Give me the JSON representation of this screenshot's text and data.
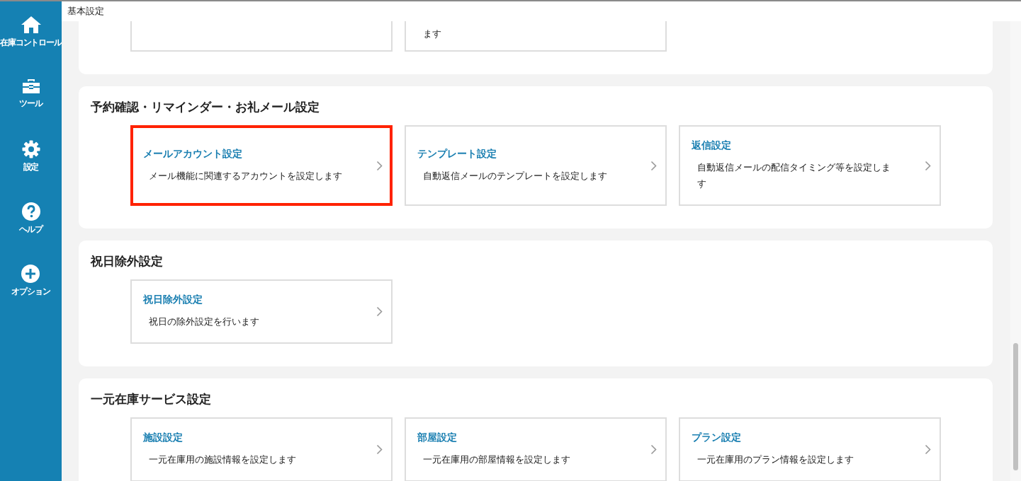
{
  "sidebar": {
    "items": [
      {
        "kind": "home",
        "label": "在庫コントロール"
      },
      {
        "kind": "toolbox",
        "label": "ツール"
      },
      {
        "kind": "gear",
        "label": "設定"
      },
      {
        "kind": "help",
        "label": "ヘルプ"
      },
      {
        "kind": "plus",
        "label": "オプション"
      }
    ]
  },
  "header": {
    "title": "基本設定"
  },
  "partial_section": {
    "cards": [
      {
        "kind": "blank"
      },
      {
        "kind": "text",
        "description": "ます"
      }
    ]
  },
  "sections": [
    {
      "title": "予約確認・リマインダー・お礼メール設定",
      "cards": [
        {
          "title": "メールアカウント設定",
          "description": "メール機能に関連するアカウントを設定します",
          "highlighted": true
        },
        {
          "title": "テンプレート設定",
          "description": "自動返信メールのテンプレートを設定します",
          "highlighted": false
        },
        {
          "title": "返信設定",
          "description": "自動返信メールの配信タイミング等を設定します",
          "highlighted": false
        }
      ]
    },
    {
      "title": "祝日除外設定",
      "cards": [
        {
          "title": "祝日除外設定",
          "description": "祝日の除外設定を行います",
          "highlighted": false
        }
      ]
    },
    {
      "title": "一元在庫サービス設定",
      "cards": [
        {
          "title": "施設設定",
          "description": "一元在庫用の施設情報を設定します",
          "highlighted": false
        },
        {
          "title": "部屋設定",
          "description": "一元在庫用の部屋情報を設定します",
          "highlighted": false
        },
        {
          "title": "プラン設定",
          "description": "一元在庫用のプラン情報を設定します",
          "highlighted": false
        }
      ]
    }
  ]
}
